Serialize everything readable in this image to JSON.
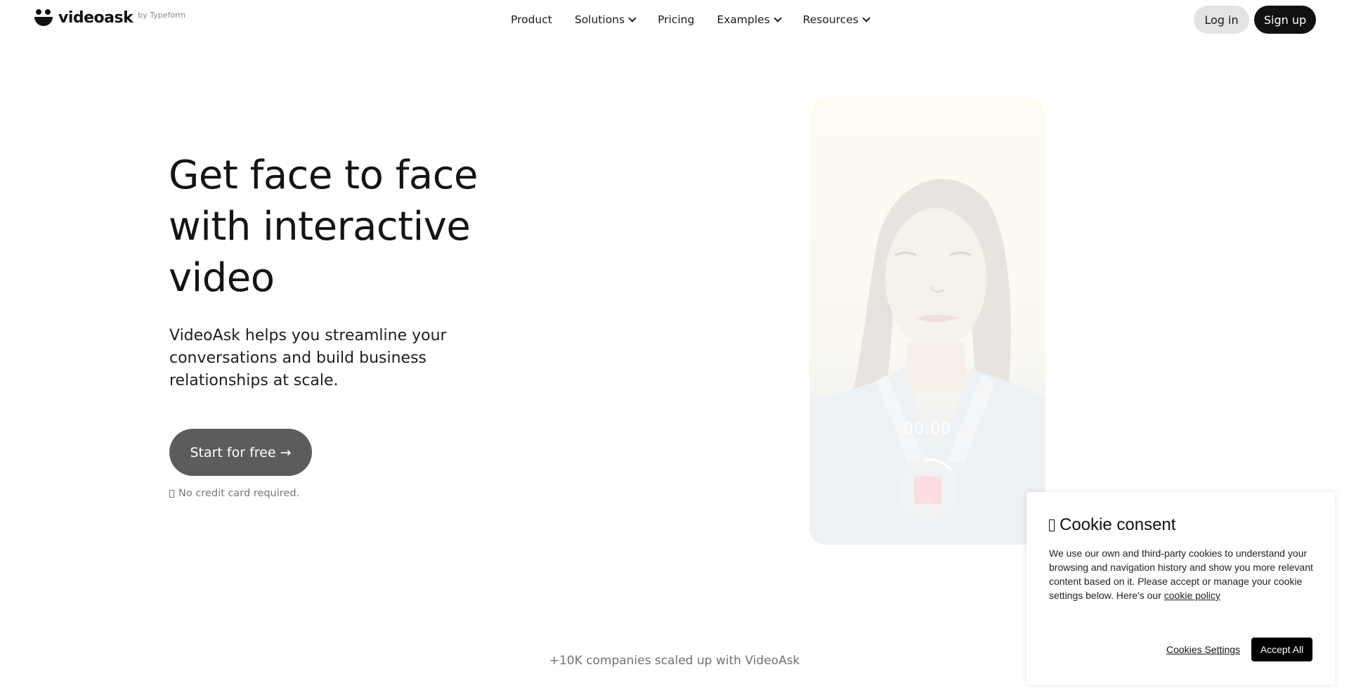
{
  "header": {
    "logo": {
      "wordmark": "videoask",
      "byline": "by Typeform",
      "icon": "smiley-logo-icon"
    },
    "nav": [
      {
        "label": "Product",
        "has_dropdown": false
      },
      {
        "label": "Solutions",
        "has_dropdown": true
      },
      {
        "label": "Pricing",
        "has_dropdown": false
      },
      {
        "label": "Examples",
        "has_dropdown": true
      },
      {
        "label": "Resources",
        "has_dropdown": true
      }
    ],
    "login_label": "Log in",
    "signup_label": "Sign up"
  },
  "hero": {
    "title": "Get face to face with interactive video",
    "subtitle": "VideoAsk helps you streamline your conversations and build business relationships at scale.",
    "cta_label": "Start for free →",
    "note": "No credit card required."
  },
  "video": {
    "timer": "00:00",
    "record_state": "recording",
    "stop_color": "#fcdde2"
  },
  "companies": {
    "text": "+10K companies scaled up with VideoAsk"
  },
  "cookie": {
    "title": "Cookie consent",
    "body": "We use our own and third-party cookies to understand your browsing and navigation history and show you more relevant content based on it. Please accept or manage your cookie settings below. Here's our ",
    "policy_link": "cookie policy",
    "settings_label": "Cookies Settings",
    "accept_label": "Accept All"
  },
  "colors": {
    "cta_bg": "#5c5c5c",
    "signup_bg": "#111111",
    "login_bg": "#e3e3e3",
    "muted_text": "#727272"
  }
}
